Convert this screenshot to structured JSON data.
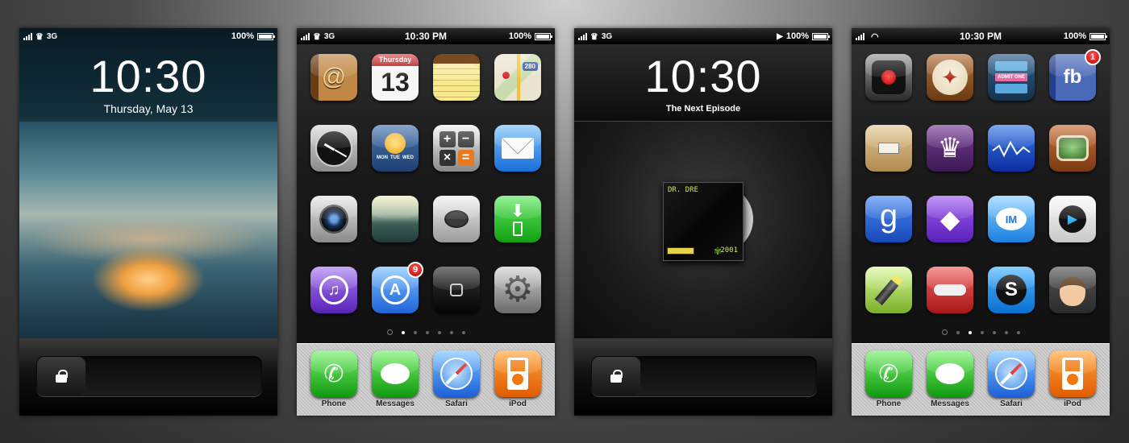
{
  "colors": {
    "status_bar": "#000000",
    "lock_bar": "#111111",
    "dock": "#c8c8c8",
    "badge": "#d11111"
  },
  "screen1": {
    "status": {
      "carrier": "3G",
      "battery": "100%"
    },
    "clock": "10:30",
    "date": "Thursday, May 13",
    "wallpaper": "blurred-sunset",
    "lock_icon": "padlock-icon"
  },
  "screen2": {
    "status": {
      "carrier": "3G",
      "time": "10:30 PM",
      "battery": "100%"
    },
    "apps": [
      {
        "name": "contacts-app",
        "icon": "at-sign-icon"
      },
      {
        "name": "calendar-app",
        "icon": "calendar-icon",
        "header": "Thursday",
        "day": "13"
      },
      {
        "name": "notes-app",
        "icon": "notepad-icon"
      },
      {
        "name": "maps-app",
        "icon": "map-icon",
        "road": "280"
      },
      {
        "name": "clock-app",
        "icon": "clock-icon"
      },
      {
        "name": "weather-app",
        "icon": "sun-icon",
        "days": [
          "MON",
          "TUE",
          "WED"
        ]
      },
      {
        "name": "calculator-app",
        "icon": "calculator-icon"
      },
      {
        "name": "mail-app",
        "icon": "envelope-icon"
      },
      {
        "name": "camera-app",
        "icon": "camera-icon"
      },
      {
        "name": "photos-app",
        "icon": "landscape-icon"
      },
      {
        "name": "sms-app",
        "icon": "speech-bubble-icon"
      },
      {
        "name": "installer-app",
        "icon": "download-icon"
      },
      {
        "name": "itunes-app",
        "icon": "music-note-icon"
      },
      {
        "name": "appstore-app",
        "icon": "app-store-icon",
        "badge": "9"
      },
      {
        "name": "home-button-app",
        "icon": "home-square-icon"
      },
      {
        "name": "settings-app",
        "icon": "gear-icon"
      }
    ],
    "dock": [
      {
        "label": "Phone",
        "icon": "phone-icon"
      },
      {
        "label": "Messages",
        "icon": "message-icon"
      },
      {
        "label": "Safari",
        "icon": "compass-icon"
      },
      {
        "label": "iPod",
        "icon": "ipod-icon"
      }
    ],
    "page_count": 7,
    "active_page": 1
  },
  "screen3": {
    "status": {
      "carrier": "3G",
      "battery": "100%"
    },
    "clock": "10:30",
    "track": "The Next Episode",
    "album": {
      "artist": "DR. DRE",
      "year": "2001"
    },
    "lock_icon": "padlock-icon"
  },
  "screen4": {
    "status": {
      "carrier": "wifi",
      "time": "10:30 PM",
      "battery": "100%"
    },
    "apps": [
      {
        "name": "voice-recorder-app",
        "icon": "record-icon"
      },
      {
        "name": "compass-app",
        "icon": "compass-rose-icon"
      },
      {
        "name": "ticket-app",
        "icon": "film-ticket-icon",
        "ticket": "ADMIT ONE"
      },
      {
        "name": "facebook-app",
        "icon": "facebook-icon",
        "text": "fb",
        "badge": "1"
      },
      {
        "name": "package-app",
        "icon": "parcel-icon"
      },
      {
        "name": "chess-app",
        "icon": "crown-icon"
      },
      {
        "name": "stocks-app",
        "icon": "stock-chart-icon"
      },
      {
        "name": "retro-tv-app",
        "icon": "tv-icon"
      },
      {
        "name": "google-app",
        "icon": "google-g-icon",
        "text": "g"
      },
      {
        "name": "gem-app",
        "icon": "gem-icon"
      },
      {
        "name": "im-app",
        "icon": "im-bubble-icon",
        "text": "IM"
      },
      {
        "name": "video-app",
        "icon": "play-icon"
      },
      {
        "name": "flashlight-app",
        "icon": "flashlight-icon"
      },
      {
        "name": "helicopter-app",
        "icon": "helicopter-icon"
      },
      {
        "name": "shazam-app",
        "icon": "shazam-icon"
      },
      {
        "name": "avatar-app",
        "icon": "cartoon-face-icon"
      }
    ],
    "dock": [
      {
        "label": "Phone",
        "icon": "phone-icon"
      },
      {
        "label": "Messages",
        "icon": "message-icon"
      },
      {
        "label": "Safari",
        "icon": "compass-icon"
      },
      {
        "label": "iPod",
        "icon": "ipod-icon"
      }
    ],
    "page_count": 7,
    "active_page": 2
  }
}
